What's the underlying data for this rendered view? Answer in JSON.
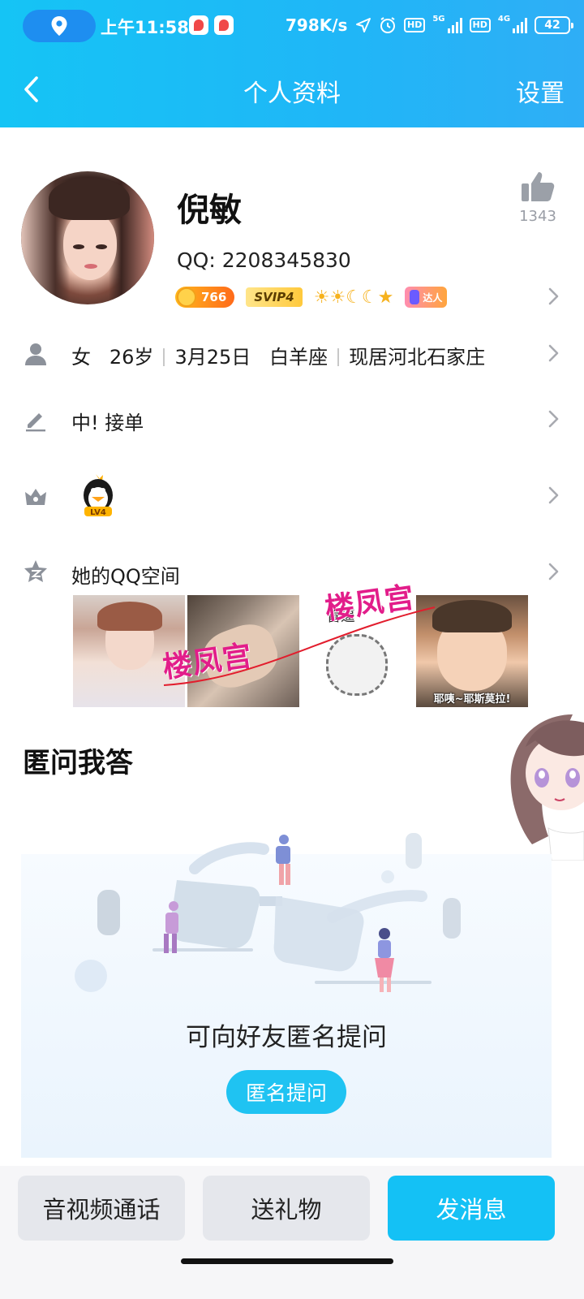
{
  "status_bar": {
    "time": "上午11:58",
    "net_speed": "798K/s",
    "battery": "42",
    "sim1": "5G",
    "sim2": "4G",
    "hd": "HD"
  },
  "nav": {
    "title": "个人资料",
    "settings": "设置"
  },
  "profile": {
    "name": "倪敏",
    "qq_id": "QQ: 2208345830",
    "likes": "1343",
    "badges": {
      "coins": "766",
      "svip": "SVIP4",
      "level_icons": "☀☀☾☾★",
      "daren": "达人"
    }
  },
  "info": {
    "gender": "女",
    "age": "26岁",
    "birthday": "3月25日",
    "zodiac": "白羊座",
    "location": "现居河北石家庄"
  },
  "signature": "中! 接单",
  "qq_level": "LV4",
  "qzone": {
    "label": "她的QQ空间",
    "photos": [
      {
        "caption": ""
      },
      {
        "caption": ""
      },
      {
        "caption": "管逼"
      },
      {
        "caption": "耶咦~耶斯莫拉!"
      }
    ],
    "watermark": "楼凤宫"
  },
  "anon_qa": {
    "title": "匿问我答",
    "hint": "可向好友匿名提问",
    "button": "匿名提问"
  },
  "actions": {
    "call": "音视频通话",
    "gift": "送礼物",
    "message": "发消息"
  },
  "colors": {
    "header": "#1cbcf6",
    "accent": "#14c1f5",
    "watermark": "#e21d8a"
  }
}
